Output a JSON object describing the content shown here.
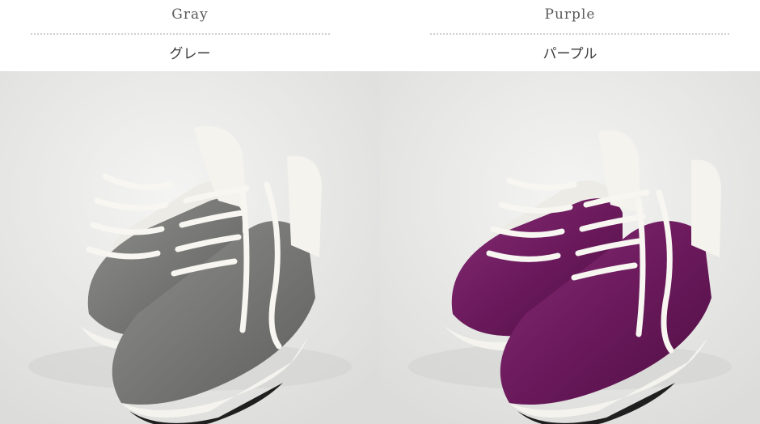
{
  "variants": [
    {
      "label_en": "Gray",
      "label_ja": "グレー",
      "shoe_color": "#767674",
      "shoe_shadow": "#5b5b59",
      "shoe_highlight": "#8d8d8a"
    },
    {
      "label_en": "Purple",
      "label_ja": "パープル",
      "shoe_color": "#6b1a5c",
      "shoe_shadow": "#4f0f43",
      "shoe_highlight": "#842a73"
    }
  ],
  "colors": {
    "background_light": "#f1f1f0",
    "background_dark": "#dedede",
    "trim_white": "#f4f3ee",
    "lace_white": "#f7f6f1",
    "sole_black": "#1f1f1f"
  }
}
